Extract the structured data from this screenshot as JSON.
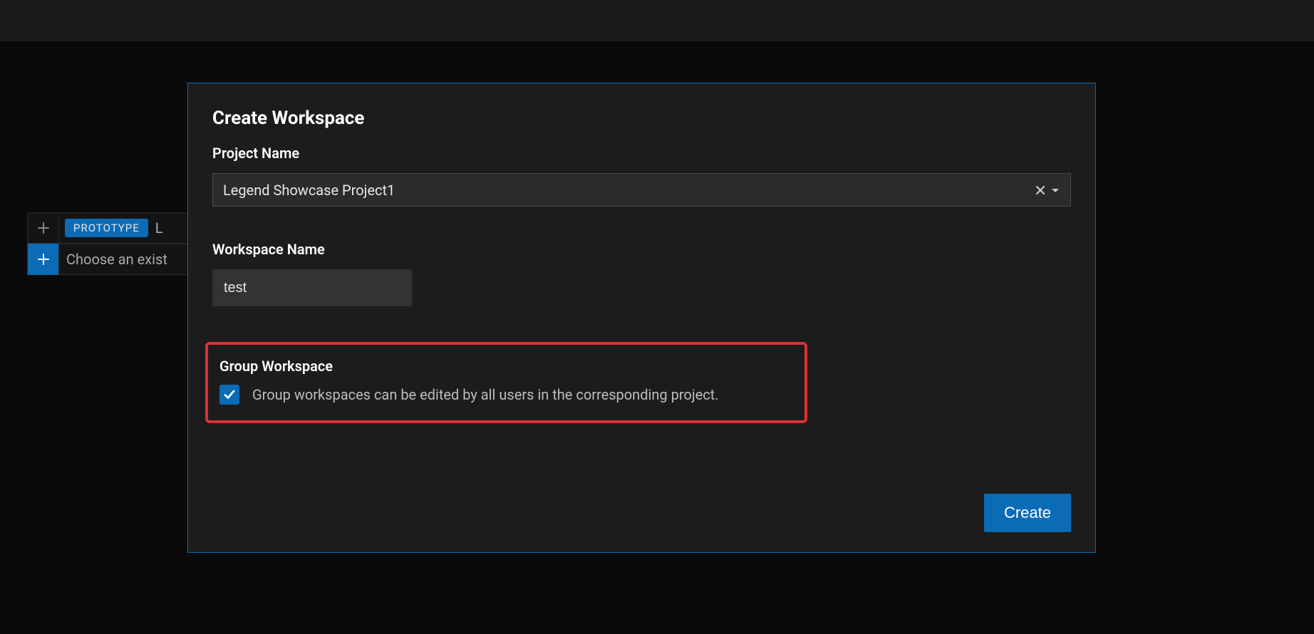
{
  "background": {
    "prototype_badge": "PROTOTYPE",
    "row1_text": "L",
    "row2_text": "Choose an exist"
  },
  "modal": {
    "title": "Create Workspace",
    "project_name_label": "Project Name",
    "project_name_value": "Legend Showcase Project1",
    "workspace_name_label": "Workspace Name",
    "workspace_name_value": "test",
    "group_workspace_label": "Group Workspace",
    "group_workspace_description": "Group workspaces can be edited by all users in the corresponding project.",
    "group_workspace_checked": true,
    "create_button": "Create"
  }
}
